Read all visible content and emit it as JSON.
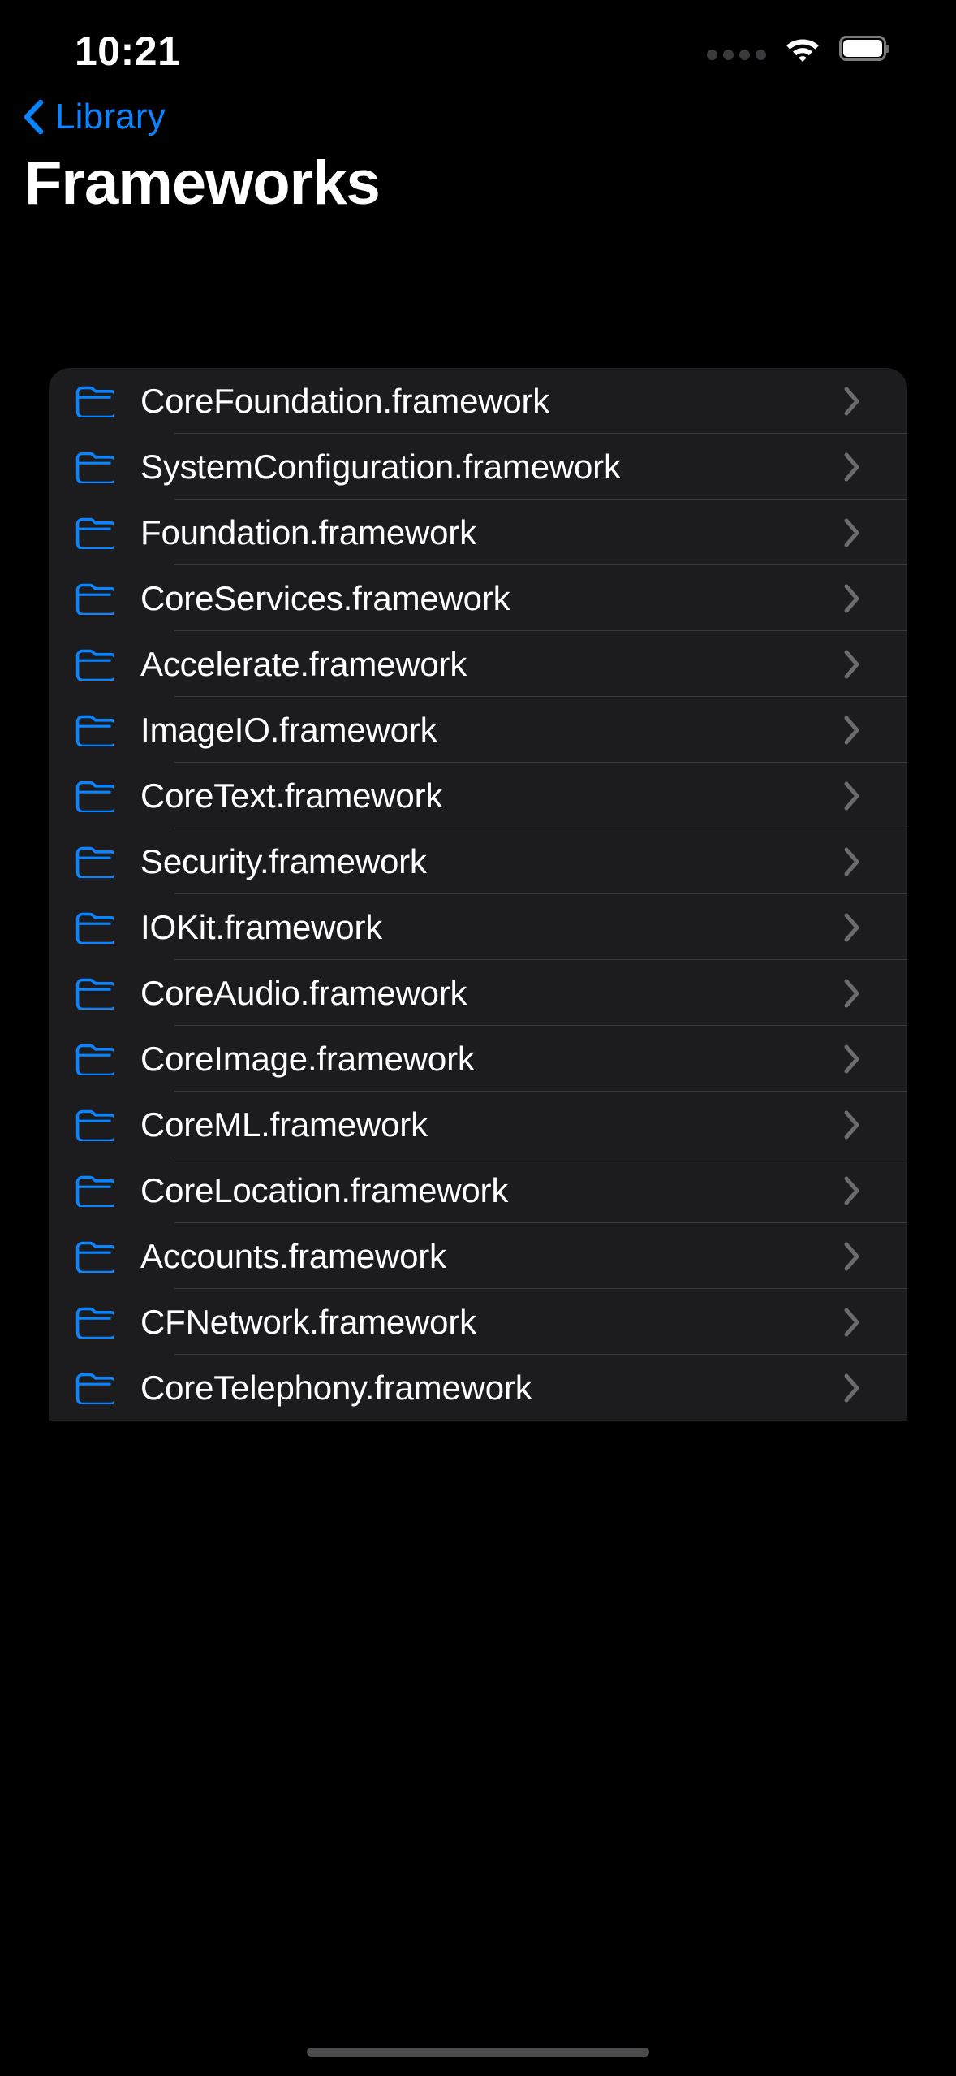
{
  "status_bar": {
    "time": "10:21",
    "cellular_icon": "cellular-dots-icon",
    "cellular_dots": 4,
    "wifi_icon": "wifi-icon",
    "battery_icon": "battery-full-icon"
  },
  "nav": {
    "back_icon": "chevron-left-icon",
    "back_label": "Library"
  },
  "page_title": "Frameworks",
  "colors": {
    "background": "#000000",
    "card": "#1c1c1e",
    "accent": "#0a84ff",
    "separator": "#38383a",
    "chevron": "#6c6c70",
    "text": "#ffffff"
  },
  "list": {
    "row_icon": "folder-icon",
    "row_accessory_icon": "chevron-right-icon",
    "items": [
      {
        "label": "CoreFoundation.framework"
      },
      {
        "label": "SystemConfiguration.framework"
      },
      {
        "label": "Foundation.framework"
      },
      {
        "label": "CoreServices.framework"
      },
      {
        "label": "Accelerate.framework"
      },
      {
        "label": "ImageIO.framework"
      },
      {
        "label": "CoreText.framework"
      },
      {
        "label": "Security.framework"
      },
      {
        "label": "IOKit.framework"
      },
      {
        "label": "CoreAudio.framework"
      },
      {
        "label": "CoreImage.framework"
      },
      {
        "label": "CoreML.framework"
      },
      {
        "label": "CoreLocation.framework"
      },
      {
        "label": "Accounts.framework"
      },
      {
        "label": "CFNetwork.framework"
      },
      {
        "label": "CoreTelephony.framework"
      }
    ]
  },
  "home_indicator": "home-indicator"
}
